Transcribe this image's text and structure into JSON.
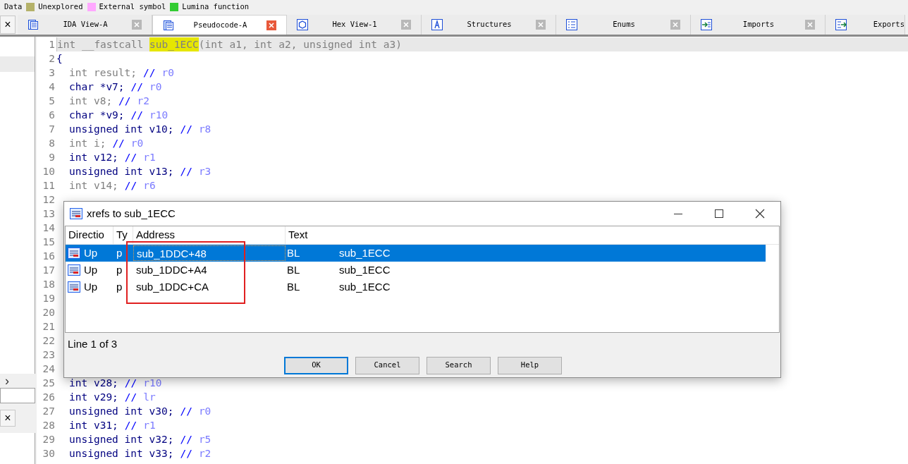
{
  "legend": [
    {
      "label": "Data"
    },
    {
      "label": "Unexplored",
      "color": "#b5b26a"
    },
    {
      "label": "External symbol",
      "color": "#ffa8ff"
    },
    {
      "label": "Lumina function",
      "color": "#33cc33"
    }
  ],
  "side_panel": {
    "close_top": "×",
    "expand": "›",
    "close_bottom": "×"
  },
  "tabs": [
    {
      "label": "IDA View-A",
      "kind": "disasm",
      "selected": false,
      "closable": true
    },
    {
      "label": "Pseudocode-A",
      "kind": "pseudo",
      "selected": true,
      "closable": true
    },
    {
      "label": "Hex View-1",
      "kind": "hex",
      "selected": false,
      "closable": true
    },
    {
      "label": "Structures",
      "kind": "struct",
      "selected": false,
      "closable": true
    },
    {
      "label": "Enums",
      "kind": "enum",
      "selected": false,
      "closable": true
    },
    {
      "label": "Imports",
      "kind": "imports",
      "selected": false,
      "closable": true
    },
    {
      "label": "Exports",
      "kind": "exports",
      "selected": false,
      "closable": false
    }
  ],
  "code": [
    {
      "number": "1",
      "kind": "signature",
      "current": true,
      "before": "int __fastcall ",
      "name": "sub_1ECC",
      "after": "(int a1, int a2, unsigned int a3)"
    },
    {
      "number": "2",
      "kind": "plain",
      "text": "{"
    },
    {
      "number": "3",
      "kind": "decl",
      "dimmed": true,
      "text": "int result;",
      "slashes": "//",
      "reg": "r0"
    },
    {
      "number": "4",
      "kind": "decl",
      "dimmed": false,
      "text": "char *v7;",
      "slashes": "//",
      "reg": "r0"
    },
    {
      "number": "5",
      "kind": "decl",
      "dimmed": true,
      "text": "int v8;",
      "slashes": "//",
      "reg": "r2"
    },
    {
      "number": "6",
      "kind": "decl",
      "dimmed": false,
      "text": "char *v9;",
      "slashes": "//",
      "reg": "r10"
    },
    {
      "number": "7",
      "kind": "decl",
      "dimmed": false,
      "text": "unsigned int v10;",
      "slashes": "//",
      "reg": "r8"
    },
    {
      "number": "8",
      "kind": "decl",
      "dimmed": true,
      "text": "int i;",
      "slashes": "//",
      "reg": "r0"
    },
    {
      "number": "9",
      "kind": "decl",
      "dimmed": false,
      "text": "int v12;",
      "slashes": "//",
      "reg": "r1"
    },
    {
      "number": "10",
      "kind": "decl",
      "dimmed": false,
      "text": "unsigned int v13;",
      "slashes": "//",
      "reg": "r3"
    },
    {
      "number": "11",
      "kind": "decl",
      "dimmed": true,
      "text": "int v14;",
      "slashes": "//",
      "reg": "r6"
    },
    {
      "number": "12",
      "kind": "hidden"
    },
    {
      "number": "13",
      "kind": "hidden"
    },
    {
      "number": "14",
      "kind": "hidden"
    },
    {
      "number": "15",
      "kind": "hidden"
    },
    {
      "number": "16",
      "kind": "hidden"
    },
    {
      "number": "17",
      "kind": "hidden"
    },
    {
      "number": "18",
      "kind": "hidden"
    },
    {
      "number": "19",
      "kind": "hidden"
    },
    {
      "number": "20",
      "kind": "hidden"
    },
    {
      "number": "21",
      "kind": "hidden"
    },
    {
      "number": "22",
      "kind": "hidden"
    },
    {
      "number": "23",
      "kind": "hidden"
    },
    {
      "number": "24",
      "kind": "hidden"
    },
    {
      "number": "25",
      "kind": "decl",
      "dimmed": false,
      "text": "int v28;",
      "slashes": "//",
      "reg": "r10"
    },
    {
      "number": "26",
      "kind": "decl",
      "dimmed": false,
      "text": "int v29;",
      "slashes": "//",
      "reg": "lr"
    },
    {
      "number": "27",
      "kind": "decl",
      "dimmed": false,
      "text": "unsigned int v30;",
      "slashes": "//",
      "reg": "r0"
    },
    {
      "number": "28",
      "kind": "decl",
      "dimmed": false,
      "text": "int v31;",
      "slashes": "//",
      "reg": "r1"
    },
    {
      "number": "29",
      "kind": "decl",
      "dimmed": false,
      "text": "unsigned int v32;",
      "slashes": "//",
      "reg": "r5"
    },
    {
      "number": "30",
      "kind": "decl",
      "dimmed": false,
      "text": "unsigned int v33;",
      "slashes": "//",
      "reg": "r2"
    }
  ],
  "dialog": {
    "title": "xrefs to sub_1ECC",
    "columns": [
      "Directio",
      "Ty",
      "Address",
      "Text"
    ],
    "rows": [
      {
        "direction": "Up",
        "type": "p",
        "address": "sub_1DDC+48",
        "instr": "BL",
        "target": "sub_1ECC",
        "selected": true
      },
      {
        "direction": "Up",
        "type": "p",
        "address": "sub_1DDC+A4",
        "instr": "BL",
        "target": "sub_1ECC",
        "selected": false
      },
      {
        "direction": "Up",
        "type": "p",
        "address": "sub_1DDC+CA",
        "instr": "BL",
        "target": "sub_1ECC",
        "selected": false
      }
    ],
    "status": "Line 1 of 3",
    "buttons": [
      {
        "label": "OK",
        "default": true
      },
      {
        "label": "Cancel",
        "default": false
      },
      {
        "label": "Search",
        "default": false
      },
      {
        "label": "Help",
        "default": false
      }
    ]
  }
}
